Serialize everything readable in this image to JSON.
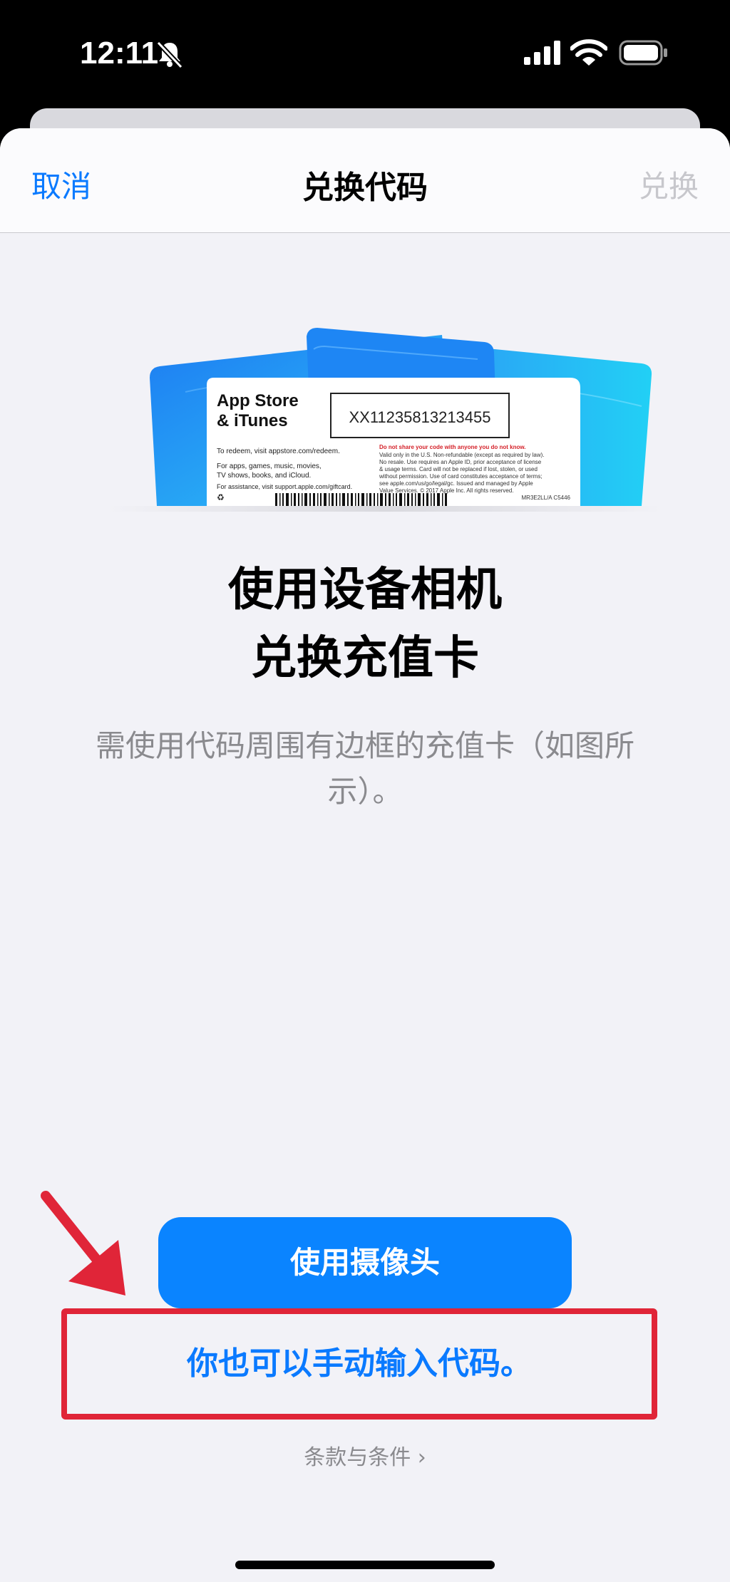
{
  "status_bar": {
    "time": "12:11"
  },
  "nav": {
    "cancel_label": "取消",
    "title": "兑换代码",
    "redeem_label": "兑换"
  },
  "card_art": {
    "brand_line1": "App Store",
    "brand_line2": "& iTunes",
    "code": "XX11235813213455",
    "left_text": [
      "To redeem, visit appstore.com/redeem.",
      "For apps, games, music, movies,",
      "TV shows, books, and iCloud.",
      "For assistance, visit support.apple.com/giftcard."
    ],
    "warning": "Do not share your code with anyone you do not know.",
    "fine_print": [
      "Valid only in the U.S. Non-refundable (except as required by law).",
      "No resale. Use requires an Apple ID, prior acceptance of license",
      "& usage terms. Card will not be replaced if lost, stolen, or used",
      "without permission. Use of card constitutes acceptance of terms;",
      "see apple.com/us/go/legal/gc. Issued and managed by Apple",
      "Value Services. © 2017 Apple Inc. All rights reserved."
    ],
    "serial": "MR3E2LL/A  C5446"
  },
  "headline": {
    "line1": "使用设备相机",
    "line2": "兑换充值卡"
  },
  "subtext": "需使用代码周围有边框的充值卡（如图所示）。",
  "camera_button_label": "使用摄像头",
  "manual_link_label": "你也可以手动输入代码。",
  "terms_label": "条款与条件",
  "colors": {
    "accent": "#0a84ff",
    "highlight": "#e02538",
    "background": "#f2f2f7"
  }
}
